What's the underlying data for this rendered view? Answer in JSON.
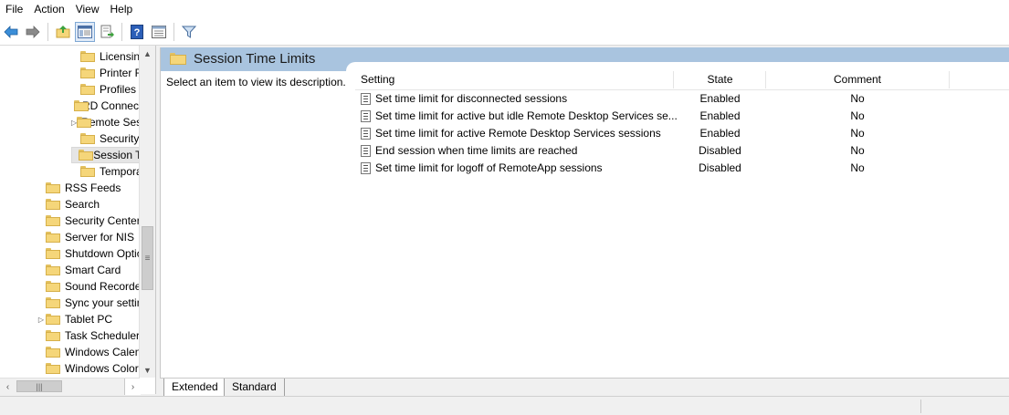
{
  "menu": [
    "File",
    "Action",
    "View",
    "Help"
  ],
  "toolbar": {
    "icons": [
      "back-arrow-icon",
      "forward-arrow-icon",
      "up-folder-icon",
      "show-hide-tree-icon",
      "export-list-icon",
      "help-icon",
      "properties-icon",
      "filter-icon"
    ]
  },
  "tree": {
    "items": [
      {
        "label": "Licensing",
        "indent": 2,
        "expander": ""
      },
      {
        "label": "Printer Redirection",
        "indent": 2,
        "expander": ""
      },
      {
        "label": "Profiles",
        "indent": 2,
        "expander": ""
      },
      {
        "label": "RD Connection Broker",
        "indent": 2,
        "expander": ""
      },
      {
        "label": "Remote Session Environment",
        "indent": 2,
        "expander": "▷"
      },
      {
        "label": "Security",
        "indent": 2,
        "expander": ""
      },
      {
        "label": "Session Time Limits",
        "indent": 2,
        "expander": "",
        "selected": true
      },
      {
        "label": "Temporary folders",
        "indent": 2,
        "expander": ""
      },
      {
        "label": "RSS Feeds",
        "indent": 1,
        "expander": ""
      },
      {
        "label": "Search",
        "indent": 1,
        "expander": ""
      },
      {
        "label": "Security Center",
        "indent": 1,
        "expander": ""
      },
      {
        "label": "Server for NIS",
        "indent": 1,
        "expander": ""
      },
      {
        "label": "Shutdown Options",
        "indent": 1,
        "expander": ""
      },
      {
        "label": "Smart Card",
        "indent": 1,
        "expander": ""
      },
      {
        "label": "Sound Recorder",
        "indent": 1,
        "expander": ""
      },
      {
        "label": "Sync your settings",
        "indent": 1,
        "expander": ""
      },
      {
        "label": "Tablet PC",
        "indent": 1,
        "expander": "▷"
      },
      {
        "label": "Task Scheduler",
        "indent": 1,
        "expander": ""
      },
      {
        "label": "Windows Calendar",
        "indent": 1,
        "expander": ""
      },
      {
        "label": "Windows Color System",
        "indent": 1,
        "expander": ""
      }
    ]
  },
  "pane": {
    "title": "Session Time Limits",
    "description": "Select an item to view its description."
  },
  "table": {
    "headers": {
      "setting": "Setting",
      "state": "State",
      "comment": "Comment"
    },
    "rows": [
      {
        "setting": "Set time limit for disconnected sessions",
        "state": "Enabled",
        "comment": "No"
      },
      {
        "setting": "Set time limit for active but idle Remote Desktop Services se...",
        "state": "Enabled",
        "comment": "No"
      },
      {
        "setting": "Set time limit for active Remote Desktop Services sessions",
        "state": "Enabled",
        "comment": "No"
      },
      {
        "setting": "End session when time limits are reached",
        "state": "Disabled",
        "comment": "No"
      },
      {
        "setting": "Set time limit for logoff of RemoteApp sessions",
        "state": "Disabled",
        "comment": "No"
      }
    ]
  },
  "tabs": {
    "extended": "Extended",
    "standard": "Standard",
    "active": "extended"
  }
}
